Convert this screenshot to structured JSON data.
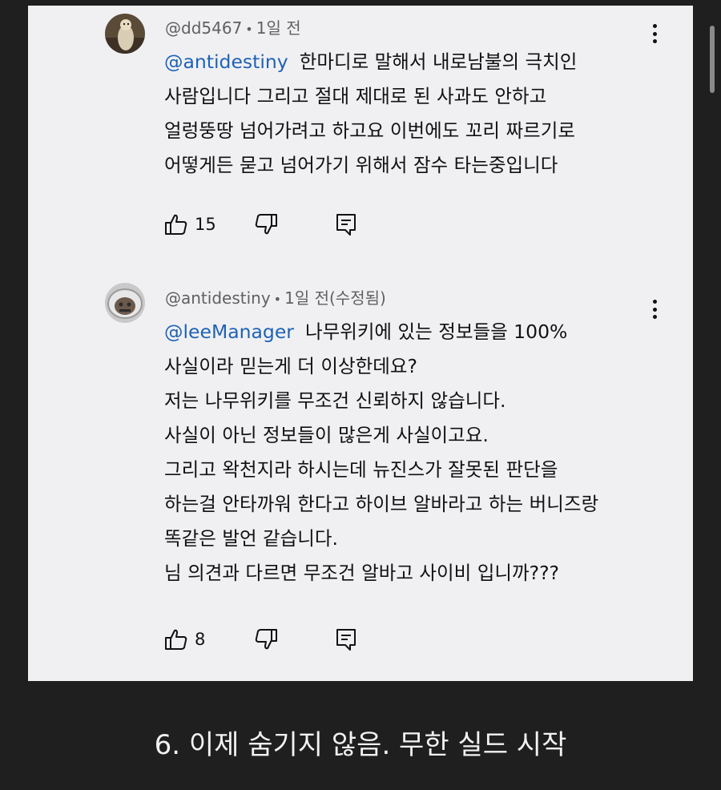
{
  "comments": [
    {
      "author": "@dd5467",
      "time": "1일 전",
      "mention": "@antidestiny",
      "lines": [
        "한마디로 말해서 내로남불의 극치인",
        "사람입니다 그리고 절대 제대로 된 사과도 안하고",
        "얼렁뚱땅 넘어가려고 하고요 이번에도 꼬리 짜르기로",
        "어떻게든 묻고 넘어가기 위해서 잠수 타는중입니다"
      ],
      "likes": "15"
    },
    {
      "author": "@antidestiny",
      "time": "1일 전(수정됨)",
      "mention": "@leeManager",
      "lines": [
        "나무위키에 있는 정보들을 100%",
        "사실이라 믿는게 더 이상한데요?",
        "저는 나무위키를 무조건 신뢰하지 않습니다.",
        "사실이 아닌 정보들이 많은게 사실이고요.",
        "그리고 왁천지라 하시는데 뉴진스가 잘못된 판단을",
        "하는걸 안타까워 한다고 하이브 알바라고 하는 버니즈랑",
        "똑같은 발언 같습니다.",
        "님 의견과 다르면 무조건 알바고 사이비 입니까???"
      ],
      "likes": "8"
    }
  ],
  "separator": "•",
  "icons": {
    "like": "thumbs-up-icon",
    "dislike": "thumbs-down-icon",
    "reply": "reply-icon",
    "more": "more-vertical-icon"
  },
  "caption": "6. 이제 숨기지 않음. 무한 실드 시작",
  "colors": {
    "background": "#1f1f1f",
    "panel": "#f0f0f3",
    "mention": "#1f62b5",
    "meta": "#606060"
  }
}
